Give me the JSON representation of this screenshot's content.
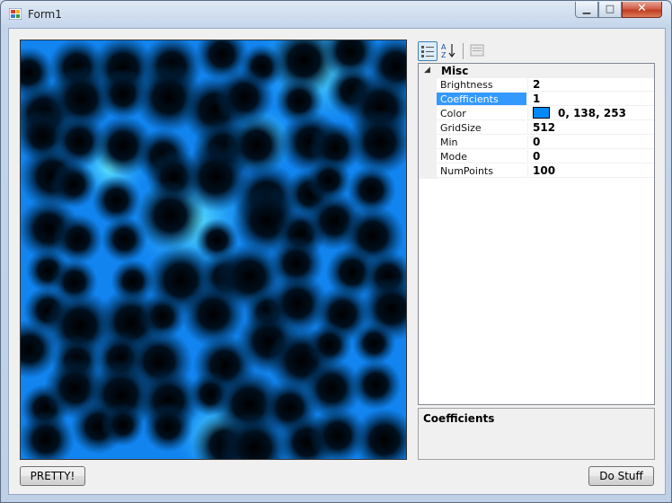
{
  "window": {
    "title": "Form1",
    "minimize_glyph": "▁",
    "maximize_glyph": "□",
    "close_glyph": "✕"
  },
  "property_grid": {
    "category": "Misc",
    "category_glyph": "◢",
    "properties": [
      {
        "name": "Brightness",
        "value": "2"
      },
      {
        "name": "Coefficients",
        "value": "1",
        "selected": true
      },
      {
        "name": "Color",
        "value": "0, 138, 253",
        "swatch": "#008afd"
      },
      {
        "name": "GridSize",
        "value": "512"
      },
      {
        "name": "Min",
        "value": "0"
      },
      {
        "name": "Mode",
        "value": "0"
      },
      {
        "name": "NumPoints",
        "value": "100"
      }
    ],
    "description_title": "Coefficients"
  },
  "buttons": {
    "pretty": "PRETTY!",
    "do_stuff": "Do Stuff"
  },
  "colors": {
    "accent": "#008afd",
    "selection": "#3399ff"
  }
}
